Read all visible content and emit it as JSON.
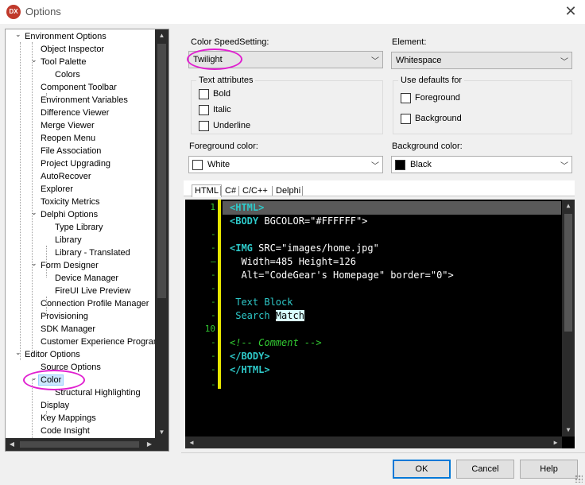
{
  "window": {
    "title": "Options",
    "app_icon_text": "DX"
  },
  "tree": {
    "items": [
      {
        "label": "Environment Options",
        "level": 0,
        "expanded": true
      },
      {
        "label": "Object Inspector",
        "level": 1
      },
      {
        "label": "Tool Palette",
        "level": 1,
        "expanded": true
      },
      {
        "label": "Colors",
        "level": 2
      },
      {
        "label": "Component Toolbar",
        "level": 1
      },
      {
        "label": "Environment Variables",
        "level": 1
      },
      {
        "label": "Difference Viewer",
        "level": 1
      },
      {
        "label": "Merge Viewer",
        "level": 1
      },
      {
        "label": "Reopen Menu",
        "level": 1
      },
      {
        "label": "File Association",
        "level": 1
      },
      {
        "label": "Project Upgrading",
        "level": 1
      },
      {
        "label": "AutoRecover",
        "level": 1
      },
      {
        "label": "Explorer",
        "level": 1
      },
      {
        "label": "Toxicity Metrics",
        "level": 1
      },
      {
        "label": "Delphi Options",
        "level": 1,
        "expanded": true
      },
      {
        "label": "Type Library",
        "level": 2
      },
      {
        "label": "Library",
        "level": 2
      },
      {
        "label": "Library - Translated",
        "level": 2
      },
      {
        "label": "Form Designer",
        "level": 1,
        "expanded": true
      },
      {
        "label": "Device Manager",
        "level": 2
      },
      {
        "label": "FireUI Live Preview",
        "level": 2
      },
      {
        "label": "Connection Profile Manager",
        "level": 1
      },
      {
        "label": "Provisioning",
        "level": 1
      },
      {
        "label": "SDK Manager",
        "level": 1
      },
      {
        "label": "Customer Experience Program",
        "level": 1
      },
      {
        "label": "Editor Options",
        "level": 0,
        "expanded": true
      },
      {
        "label": "Source Options",
        "level": 1
      },
      {
        "label": "Color",
        "level": 1,
        "expanded": true,
        "selected": true
      },
      {
        "label": "Structural Highlighting",
        "level": 2
      },
      {
        "label": "Display",
        "level": 1
      },
      {
        "label": "Key Mappings",
        "level": 1
      },
      {
        "label": "Code Insight",
        "level": 1
      }
    ]
  },
  "color_speed_setting": {
    "label": "Color SpeedSetting:",
    "value": "Twilight"
  },
  "element": {
    "label": "Element:",
    "value": "Whitespace"
  },
  "text_attributes": {
    "title": "Text attributes",
    "bold": "Bold",
    "italic": "Italic",
    "underline": "Underline"
  },
  "use_defaults": {
    "title": "Use defaults for",
    "foreground": "Foreground",
    "background": "Background"
  },
  "foreground_color": {
    "label": "Foreground color:",
    "value": "White",
    "swatch": "#ffffff"
  },
  "background_color": {
    "label": "Background color:",
    "value": "Black",
    "swatch": "#000000"
  },
  "tabs": [
    "HTML",
    "C#",
    "C/C++",
    "Delphi"
  ],
  "editor": {
    "gutter_numbers": [
      "1",
      "10"
    ],
    "lines": {
      "l1_tag": "<HTML>",
      "l2_tag": "<BODY",
      "l2_rest": " BGCOLOR=\"#FFFFFF\">",
      "l4_tag": "<IMG",
      "l4_rest": " SRC=\"images/home.jpg\"",
      "l5": "  Width=485 Height=126",
      "l6": "  Alt=\"CodeGear's Homepage\" border=\"0\">",
      "l8": " Text Block",
      "l9_a": " Search ",
      "l9_b": "Match",
      "l11": "<!-- Comment -->",
      "l12": "</BODY>",
      "l13": "</HTML>"
    }
  },
  "buttons": {
    "ok": "OK",
    "cancel": "Cancel",
    "help": "Help"
  },
  "colors": {
    "highlight_ellipse": "#e020d0",
    "editor_bg": "#000000",
    "tag": "#2ec9c9",
    "comment": "#33cc33"
  }
}
